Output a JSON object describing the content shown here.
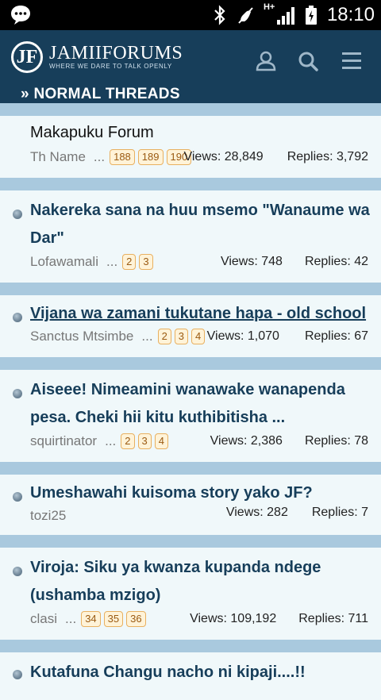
{
  "status_bar": {
    "time": "18:10",
    "network": "H+"
  },
  "header": {
    "logo_letter": "JF",
    "logo_name": "JAMIIFORUMS",
    "logo_tagline": "WHERE WE DARE TO TALK OPENLY",
    "section_title": "» NORMAL THREADS"
  },
  "threads": [
    {
      "title": "Makapuku Forum",
      "author": "Th Name",
      "dots": "...",
      "pages": [
        "188",
        "189",
        "190"
      ],
      "views": "Views: 28,849",
      "replies": "Replies: 3,792"
    },
    {
      "title_line1": "Nakereka sana na huu msemo \"Wanaume wa",
      "title_line2": "Dar\"",
      "author": "Lofawamali",
      "dots": "...",
      "pages": [
        "2",
        "3"
      ],
      "views": "Views: 748",
      "replies": "Replies: 42"
    },
    {
      "title": "Vijana wa zamani tukutane hapa - old school",
      "author": "Sanctus Mtsimbe",
      "dots": "...",
      "pages": [
        "2",
        "3",
        "4"
      ],
      "views": "Views: 1,070",
      "replies": "Replies: 67"
    },
    {
      "title_line1": "Aiseee! Nimeamini wanawake wanapenda",
      "title_line2": "pesa. Cheki hii kitu kuthibitisha ...",
      "author": "squirtinator",
      "dots": "...",
      "pages": [
        "2",
        "3",
        "4"
      ],
      "views": "Views: 2,386",
      "replies": "Replies: 78"
    },
    {
      "title": "Umeshawahi kuisoma story yako JF?",
      "author": "tozi25",
      "views": "Views: 282",
      "replies": "Replies: 7"
    },
    {
      "title_line1": "Viroja: Siku ya kwanza kupanda ndege",
      "title_line2": "(ushamba mzigo)",
      "author": "clasi",
      "dots": "...",
      "pages": [
        "34",
        "35",
        "36"
      ],
      "views": "Views: 109,192",
      "replies": "Replies: 711"
    },
    {
      "title": "Kutafuna Changu nacho ni kipaji....!!"
    }
  ],
  "icons": [
    "chat-bubble-icon",
    "bluetooth-icon",
    "mute-icon",
    "signal-icon",
    "battery-icon",
    "user-icon",
    "search-icon",
    "menu-icon"
  ],
  "colors": {
    "header_bg": "#173e5a",
    "stripe": "#a9c9de",
    "thread_bg": "#f0f8fa",
    "title": "#173e5a",
    "page_link": "#9a5a12"
  }
}
